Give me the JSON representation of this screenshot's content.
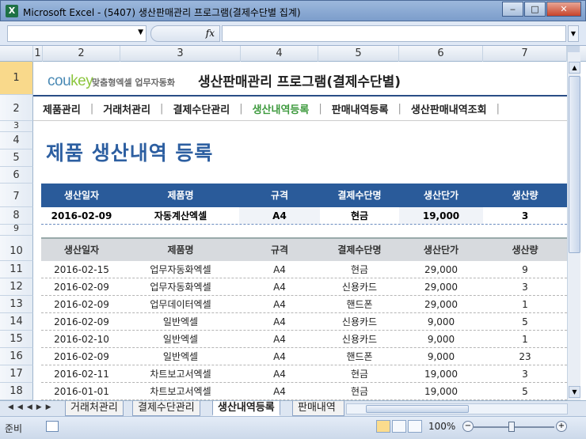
{
  "window": {
    "title": "Microsoft Excel - (5407) 생산판매관리 프로그램(결제수단별 집계)",
    "app_icon": "X"
  },
  "formula_bar": {
    "fx": "fx"
  },
  "columns": [
    "1",
    "2",
    "3",
    "4",
    "5",
    "6",
    "7"
  ],
  "rows": [
    "1",
    "2",
    "3",
    "4",
    "5",
    "6",
    "7",
    "8",
    "9",
    "10",
    "11",
    "12",
    "13",
    "14",
    "15",
    "16",
    "17",
    "18"
  ],
  "logo": {
    "brand_a": "cou",
    "brand_b": "key",
    "sub": "맞춤형엑셀 업무자동화"
  },
  "app_title": "생산판매관리 프로그램(결제수단별)",
  "menu": [
    "제품관리",
    "거래처관리",
    "결제수단관리",
    "생산내역등록",
    "판매내역등록",
    "생산판매내역조회"
  ],
  "menu_active": 3,
  "page_title": "제품 생산내역 등록",
  "headers": [
    "생산일자",
    "제품명",
    "규격",
    "결제수단명",
    "생산단가",
    "생산량"
  ],
  "input_row": [
    "2016-02-09",
    "자동계산엑셀",
    "A4",
    "현금",
    "19,000",
    "3"
  ],
  "table": [
    [
      "2016-02-15",
      "업무자동화엑셀",
      "A4",
      "현금",
      "29,000",
      "9"
    ],
    [
      "2016-02-09",
      "업무자동화엑셀",
      "A4",
      "신용카드",
      "29,000",
      "3"
    ],
    [
      "2016-02-09",
      "업무데이터엑셀",
      "A4",
      "핸드폰",
      "29,000",
      "1"
    ],
    [
      "2016-02-09",
      "일반엑셀",
      "A4",
      "신용카드",
      "9,000",
      "5"
    ],
    [
      "2016-02-10",
      "일반엑셀",
      "A4",
      "신용카드",
      "9,000",
      "1"
    ],
    [
      "2016-02-09",
      "일반엑셀",
      "A4",
      "핸드폰",
      "9,000",
      "23"
    ],
    [
      "2016-02-11",
      "차트보고서엑셀",
      "A4",
      "현금",
      "19,000",
      "3"
    ],
    [
      "2016-01-01",
      "차트보고서엑셀",
      "A4",
      "현금",
      "19,000",
      "5"
    ]
  ],
  "sheet_tabs": [
    "거래처관리",
    "결제수단관리",
    "생산내역등록",
    "판매내역"
  ],
  "active_sheet": 2,
  "status": {
    "ready": "준비",
    "zoom": "100%"
  },
  "colors": {
    "header_blue": "#2a5b9a",
    "title_blue": "#2d5fa1",
    "active_menu": "#3e9a3e"
  }
}
